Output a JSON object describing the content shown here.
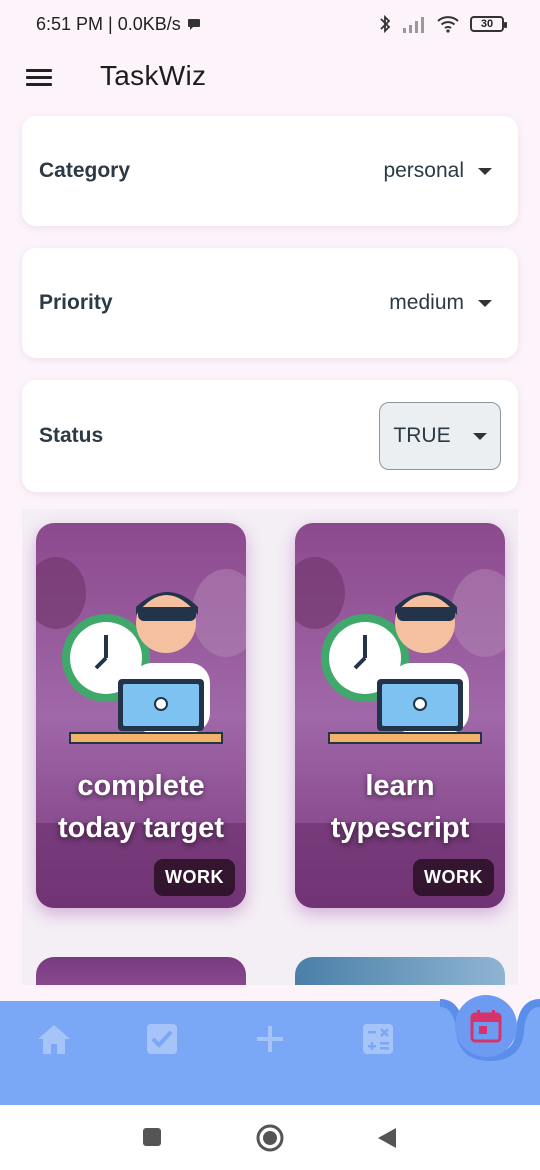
{
  "status_bar": {
    "time_network": "6:51 PM | 0.0KB/s",
    "battery": "30"
  },
  "app_bar": {
    "title": "TaskWiz"
  },
  "filters": {
    "category": {
      "label": "Category",
      "value": "personal"
    },
    "priority": {
      "label": "Priority",
      "value": "medium"
    },
    "status": {
      "label": "Status",
      "value": "TRUE"
    }
  },
  "tasks": [
    {
      "title_line1": "complete",
      "title_line2": "today target",
      "badge": "WORK"
    },
    {
      "title_line1": "learn",
      "title_line2": "typescript",
      "badge": "WORK"
    }
  ],
  "bottom_nav": {
    "items": [
      "home-icon",
      "checkbox-icon",
      "plus-icon",
      "calculator-icon",
      "calendar-icon"
    ],
    "active": "calendar-icon",
    "active_color": "#d6336c",
    "bar_color": "#7aa8f7"
  }
}
